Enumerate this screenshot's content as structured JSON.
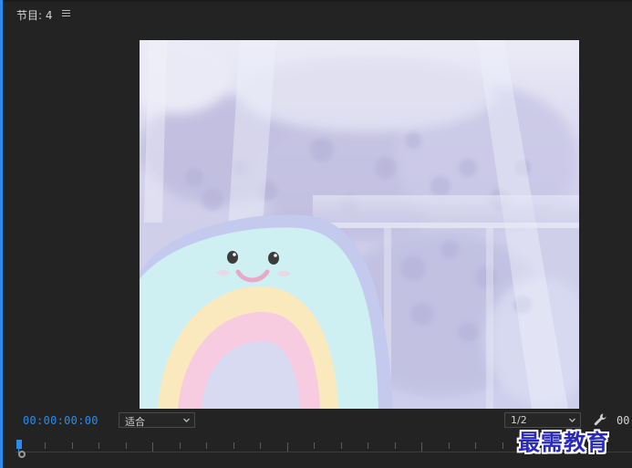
{
  "panel": {
    "title": "节目: 4",
    "menu_icon": "hamburger-menu-icon"
  },
  "playback": {
    "current_timecode": "00:00:00:00",
    "fit_option": "适合",
    "resolution": "1/2",
    "right_timecode_partial": "00",
    "settings_icon": "wrench-icon"
  },
  "watermark": {
    "text": "最需教育"
  },
  "colors": {
    "accent": "#2d8ceb",
    "panel_bg": "#232323",
    "watermark": "#2a2ab8"
  }
}
